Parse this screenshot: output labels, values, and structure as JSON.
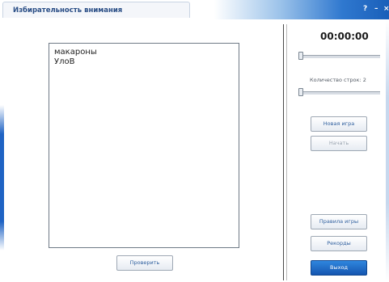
{
  "window": {
    "title": "Избирательность внимания",
    "help_label": "?",
    "minimize_label": "–",
    "close_label": "×"
  },
  "word_list": {
    "items": [
      "макароны",
      "УлоВ"
    ]
  },
  "timer": {
    "value": "00:00:00"
  },
  "timer_slider": {
    "level": 0
  },
  "rows": {
    "label": "Количество строк: 2",
    "level": 0
  },
  "buttons": {
    "new_game": "Новая игра",
    "start": "Начать",
    "check": "Проверить",
    "rules": "Правила игры",
    "records": "Рекорды",
    "exit": "Выход"
  },
  "colors": {
    "title_text": "#2a4e86",
    "button_text": "#2f5f9e",
    "exit_button": "#1a5fb9"
  }
}
